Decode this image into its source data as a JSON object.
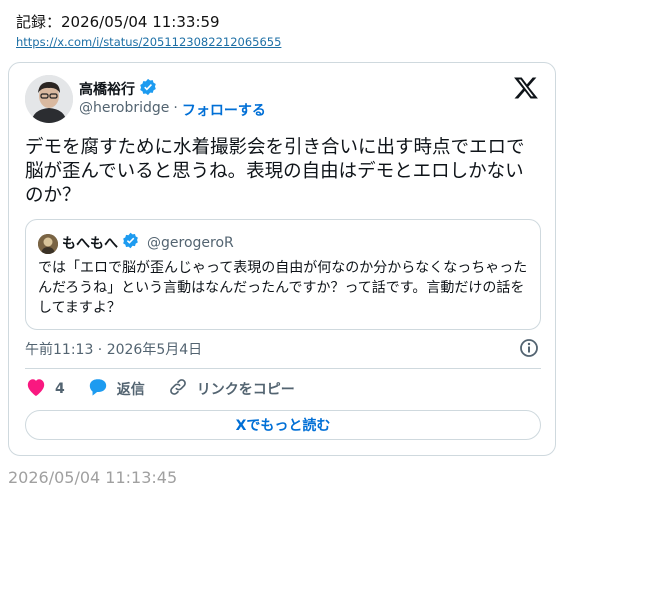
{
  "record_text": "記録：2026/05/04 11:33:59",
  "url": "https://x.com/i/status/2051123082212065655",
  "tweet": {
    "author_name": "高橋裕行",
    "author_handle": "@herobridge",
    "separator": "·",
    "follow_label": "フォローする",
    "text": "デモを腐すために水着撮影会を引き合いに出す時点でエロで脳が歪んでいると思うね。表現の自由はデモとエロしかないのか？",
    "quote": {
      "name": "もへもへ",
      "handle": "@gerogeroR",
      "text": "では「エロで脳が歪んじゃって表現の自由が何なのか分からなくなっちゃったんだろうね」という言動はなんだったんですか？って話です。言動だけの話をしてますよ？"
    },
    "timestamp": "午前11:13 · 2026年5月4日",
    "likes": "4",
    "reply_label": "返信",
    "copy_link_label": "リンクをコピー",
    "read_more_label": "Xでもっと読む"
  },
  "captured_time": "2026/05/04 11:13:45",
  "colors": {
    "verified": "#1d9bf0",
    "like": "#f91880",
    "reply": "#1d9bf0",
    "link": "#006fd6",
    "border": "#cfd9de"
  },
  "icons": [
    "verified-badge-icon",
    "x-logo-icon",
    "heart-icon",
    "reply-bubble-icon",
    "link-icon",
    "info-icon"
  ]
}
